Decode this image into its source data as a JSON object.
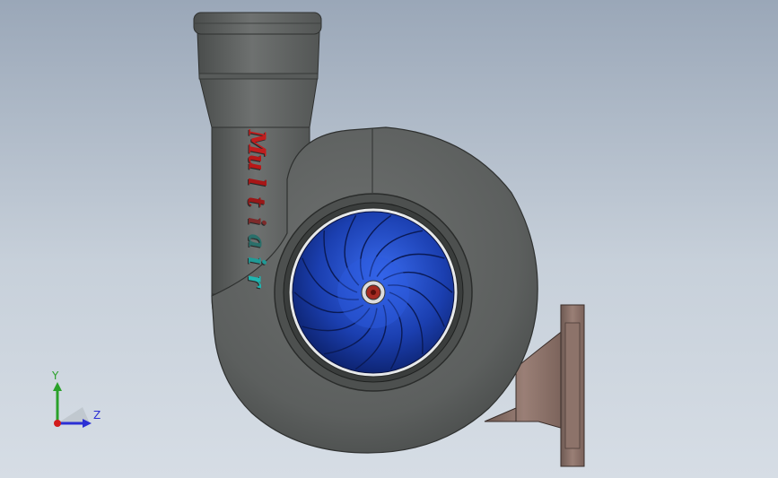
{
  "viewport": {
    "background_top": "#9aa7b8",
    "background_bottom": "#d6dde5"
  },
  "model": {
    "name": "centrifugal-blower",
    "housing_color": "#5f6261",
    "impeller_color": "#1b3fb0",
    "flange_color": "#8a6e66",
    "label_letters": [
      {
        "char": "M",
        "color": "#c21d1d"
      },
      {
        "char": "u",
        "color": "#b81818"
      },
      {
        "char": "l",
        "color": "#a81616"
      },
      {
        "char": "t",
        "color": "#9a1717"
      },
      {
        "char": "i",
        "color": "#7d2a2a"
      },
      {
        "char": "a",
        "color": "#2a6f6a"
      },
      {
        "char": "i",
        "color": "#1f9a96"
      },
      {
        "char": "r",
        "color": "#1fb5b0"
      }
    ]
  },
  "triad": {
    "y_label": "Y",
    "z_label": "Z",
    "y_color": "#2aa12a",
    "z_color": "#2b2fd4",
    "x_color": "#d21c1c"
  }
}
